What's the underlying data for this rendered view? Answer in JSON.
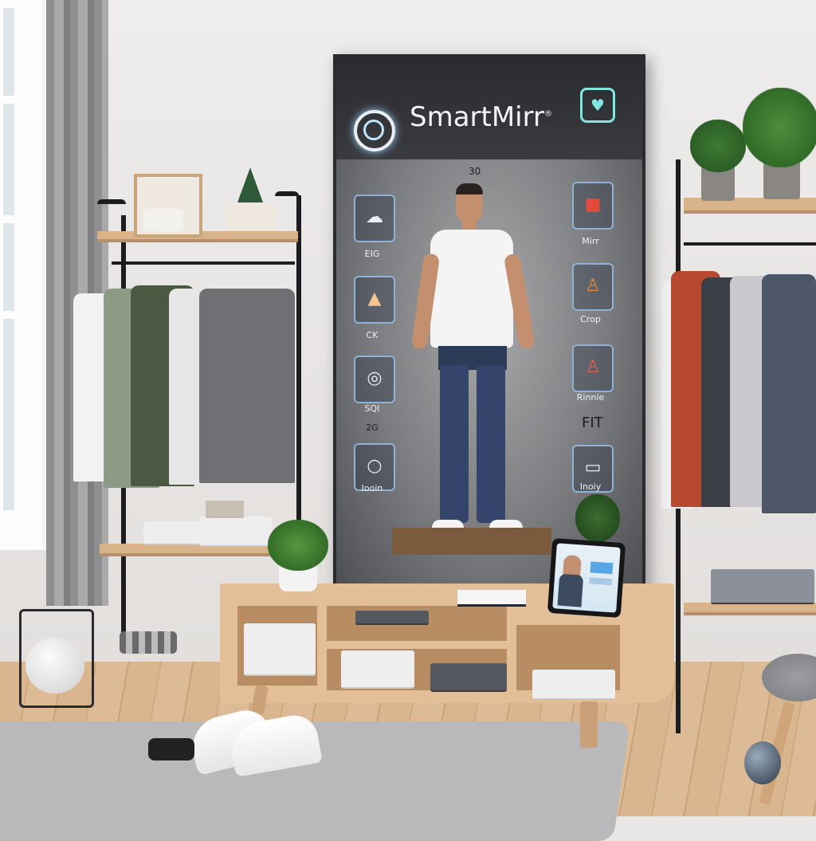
{
  "mirror": {
    "brand": "SmartMirr",
    "brand_mark": "®",
    "top_value": "30",
    "left_tiles": [
      {
        "icon": "cloud-icon",
        "label": "EIG"
      },
      {
        "icon": "triangle-icon",
        "label": "CK"
      },
      {
        "icon": "face-icon",
        "label": "SQI"
      },
      {
        "icon": "ring-icon",
        "label": "Iooin"
      }
    ],
    "left_extra": "2G",
    "right_tiles": [
      {
        "icon": "red-screen-icon",
        "label": "Mirr"
      },
      {
        "icon": "body-orange-icon",
        "label": "Crop"
      },
      {
        "icon": "body-red-icon",
        "label": "Rinnie"
      },
      {
        "icon": "screen-icon",
        "label": "Inoiy"
      }
    ],
    "right_extra": "FIT"
  },
  "colors": {
    "accent_cyan": "#7fe6e0",
    "tile_border": "#8fb3d6",
    "alert_red": "#e44a3a"
  }
}
